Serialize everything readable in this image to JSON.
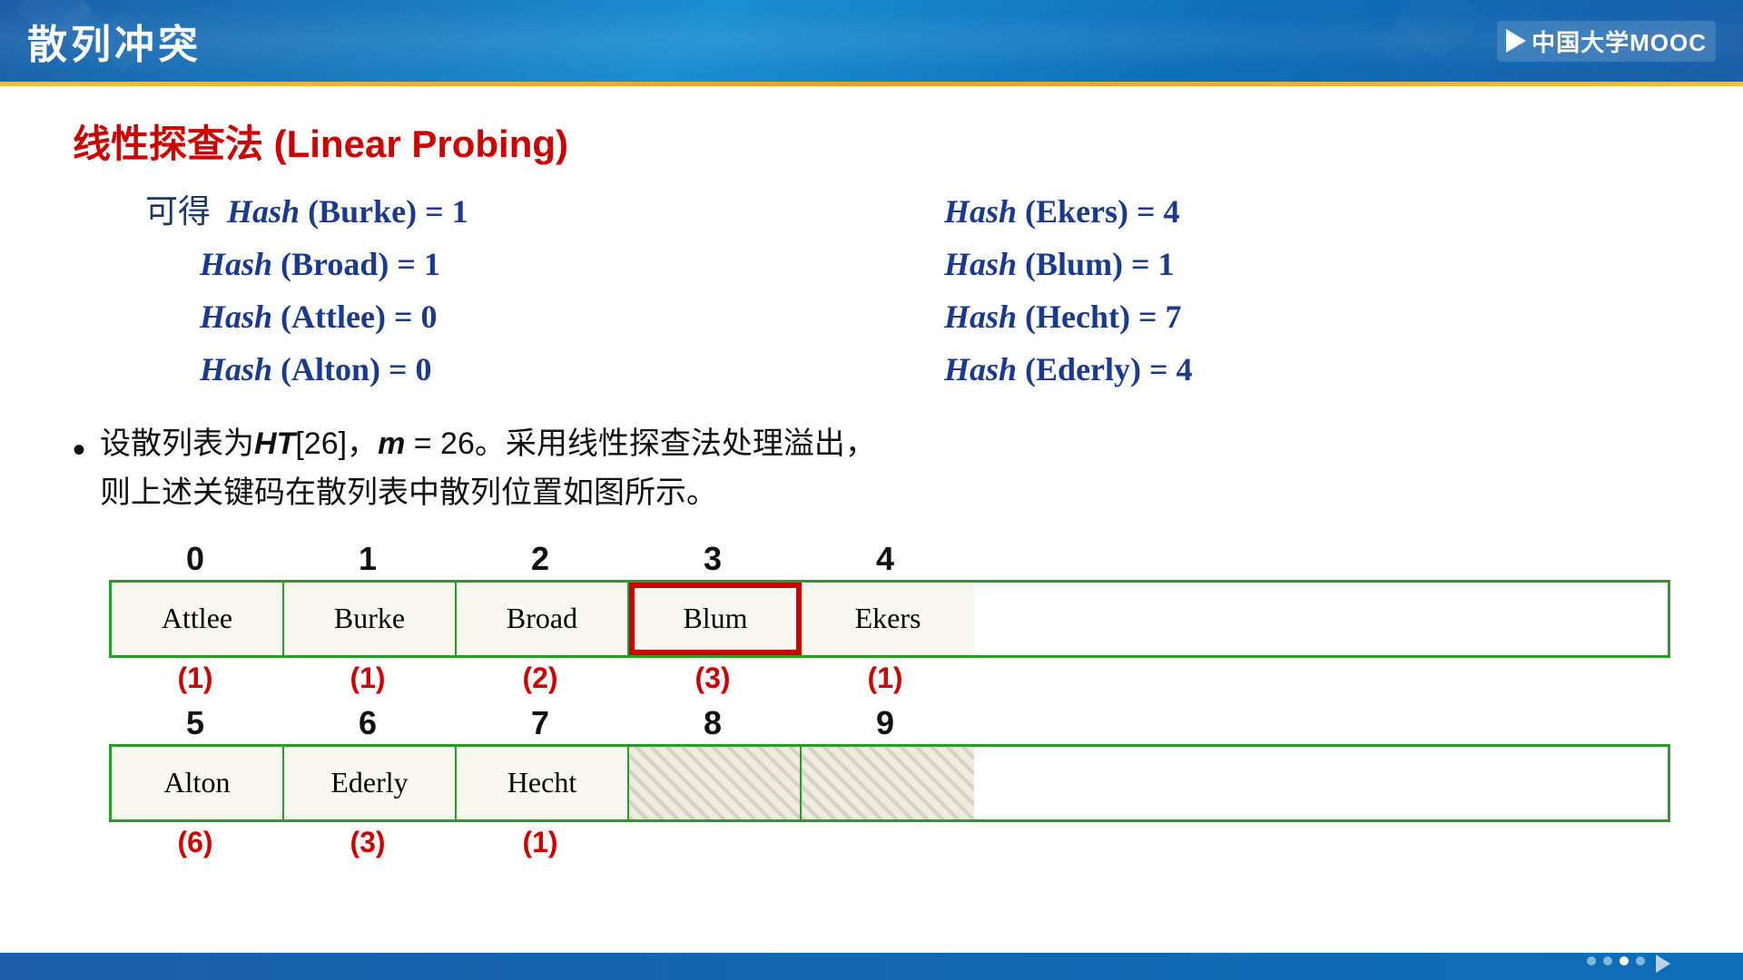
{
  "header": {
    "title": "散列冲突",
    "logo_text": "中国大学MOOC"
  },
  "section_title": "线性探查法 (Linear Probing)",
  "formulas": [
    {
      "left": {
        "hash": "Hash",
        "name": "Burke",
        "eq": "= 1"
      },
      "right": {
        "hash": "Hash",
        "name": "Ekers",
        "eq": "= 4"
      }
    },
    {
      "left": {
        "hash": "Hash",
        "name": "Broad",
        "eq": "= 1"
      },
      "right": {
        "hash": "Hash",
        "name": "Blum",
        "eq": "= 1"
      }
    },
    {
      "left": {
        "hash": "Hash",
        "name": "Attlee",
        "eq": "= 0"
      },
      "right": {
        "hash": "Hash",
        "name": "Hecht",
        "eq": "= 7"
      }
    },
    {
      "left": {
        "hash": "Hash",
        "name": "Alton",
        "eq": "= 0"
      },
      "right": {
        "hash": "Hash",
        "name": "Ederly",
        "eq": "= 4"
      }
    }
  ],
  "bullet_text": "设散列表为HT[26]，m = 26。采用线性探查法处理溢出，则上述关键码在散列表中散列位置如图所示。",
  "table1": {
    "col_headers": [
      "0",
      "1",
      "2",
      "3",
      "4"
    ],
    "cells": [
      {
        "name": "Attlee",
        "empty": false,
        "highlighted": false
      },
      {
        "name": "Burke",
        "empty": false,
        "highlighted": false
      },
      {
        "name": "Broad",
        "empty": false,
        "highlighted": false
      },
      {
        "name": "Blum",
        "empty": false,
        "highlighted": true
      },
      {
        "name": "Ekers",
        "empty": false,
        "highlighted": false
      }
    ],
    "probe_counts": [
      "(1)",
      "(1)",
      "(2)",
      "(3)",
      "(1)"
    ]
  },
  "table2": {
    "col_headers": [
      "5",
      "6",
      "7",
      "8",
      "9"
    ],
    "cells": [
      {
        "name": "Alton",
        "empty": false
      },
      {
        "name": "Ederly",
        "empty": false
      },
      {
        "name": "Hecht",
        "empty": false
      },
      {
        "name": "",
        "empty": true
      },
      {
        "name": "",
        "empty": true
      }
    ],
    "probe_counts": [
      "(6)",
      "(3)",
      "(1)",
      "",
      ""
    ]
  },
  "footer": {
    "dots": [
      false,
      false,
      false,
      false,
      true,
      false
    ]
  }
}
